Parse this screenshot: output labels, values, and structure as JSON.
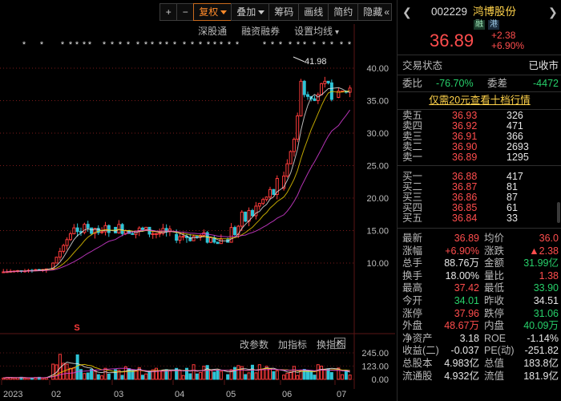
{
  "toolbar": {
    "plus": "+",
    "minus": "−",
    "fuquan": "复权",
    "diejia": "叠加",
    "chouma": "筹码",
    "huaxian": "画线",
    "jianyue": "简约",
    "yincang": "隐藏",
    "collapse": "«"
  },
  "chart_links": {
    "shen": "深股通",
    "rongzi": "融资融券",
    "settings": "设置均线"
  },
  "price_axis": [
    "40.00",
    "35.00",
    "30.00",
    "25.00",
    "20.00",
    "15.00",
    "10.00"
  ],
  "high_label": "41.98",
  "event_marker": "S",
  "volume_tools": {
    "params": "改参数",
    "add": "加指标",
    "change": "换指标",
    "close": "✕"
  },
  "volume_axis": [
    "245.00",
    "123.00",
    "0.00"
  ],
  "x_axis": [
    "2023",
    "02",
    "03",
    "04",
    "05",
    "06",
    "07"
  ],
  "chart_data": {
    "type": "candlestick",
    "y_axis_ticks": [
      10,
      15,
      20,
      25,
      30,
      35,
      40
    ],
    "volume_axis_ticks": [
      0,
      123,
      245
    ],
    "x_labels": [
      "2023",
      "02",
      "03",
      "04",
      "05",
      "06",
      "07"
    ],
    "high_annotation": 41.98,
    "colors": {
      "up": "#ff3b3b",
      "down": "#2ec4d6",
      "ma_white": "#e8e8e8",
      "ma_yellow": "#f0d000",
      "ma_magenta": "#e040e0"
    },
    "months": [
      {
        "month": "01",
        "open": 8.6,
        "high": 9.1,
        "low": 8.5,
        "close": 9.1
      },
      {
        "month": "02",
        "open": 9.1,
        "high": 17.5,
        "low": 9.0,
        "close": 15.5
      },
      {
        "month": "03",
        "open": 15.5,
        "high": 16.9,
        "low": 12.0,
        "close": 14.4
      },
      {
        "month": "04",
        "open": 14.4,
        "high": 18.6,
        "low": 13.0,
        "close": 13.6
      },
      {
        "month": "05",
        "open": 13.6,
        "high": 23.5,
        "low": 13.2,
        "close": 21.5
      },
      {
        "month": "06",
        "open": 21.5,
        "high": 41.98,
        "low": 21.0,
        "close": 35.5
      },
      {
        "month": "07",
        "open": 35.5,
        "high": 37.96,
        "low": 33.9,
        "close": 36.89
      }
    ]
  },
  "quote": {
    "code": "002229",
    "name": "鸿博股份",
    "tags": [
      "融",
      "港"
    ],
    "price": "36.89",
    "change": "+2.38",
    "change_pct": "+6.90%",
    "status_label": "交易状态",
    "status_value": "已收市",
    "weibi_label": "委比",
    "weibi_value": "-76.70%",
    "weicha_label": "委差",
    "weicha_value": "-4472",
    "promo": "仅需20元查看十档行情",
    "sell": [
      {
        "label": "卖五",
        "price": "36.93",
        "vol": "326"
      },
      {
        "label": "卖四",
        "price": "36.92",
        "vol": "471"
      },
      {
        "label": "卖三",
        "price": "36.91",
        "vol": "366"
      },
      {
        "label": "卖二",
        "price": "36.90",
        "vol": "2693"
      },
      {
        "label": "卖一",
        "price": "36.89",
        "vol": "1295"
      }
    ],
    "buy": [
      {
        "label": "买一",
        "price": "36.88",
        "vol": "417"
      },
      {
        "label": "买二",
        "price": "36.87",
        "vol": "81"
      },
      {
        "label": "买三",
        "price": "36.86",
        "vol": "87"
      },
      {
        "label": "买四",
        "price": "36.85",
        "vol": "61"
      },
      {
        "label": "买五",
        "price": "36.84",
        "vol": "33"
      }
    ],
    "stats": [
      {
        "l1": "最新",
        "v1": "36.89",
        "c1": "red",
        "l2": "均价",
        "v2": "36.0",
        "c2": "red"
      },
      {
        "l1": "涨幅",
        "v1": "+6.90%",
        "c1": "red",
        "l2": "涨跌",
        "v2": "▲2.38",
        "c2": "red"
      },
      {
        "l1": "总手",
        "v1": "88.76万",
        "c1": "white",
        "l2": "金额",
        "v2": "31.99亿",
        "c2": "green"
      },
      {
        "l1": "换手",
        "v1": "18.00%",
        "c1": "white",
        "l2": "量比",
        "v2": "1.38",
        "c2": "red"
      },
      {
        "l1": "最高",
        "v1": "37.42",
        "c1": "red",
        "l2": "最低",
        "v2": "33.90",
        "c2": "green"
      },
      {
        "l1": "今开",
        "v1": "34.01",
        "c1": "green",
        "l2": "昨收",
        "v2": "34.51",
        "c2": "white"
      },
      {
        "l1": "涨停",
        "v1": "37.96",
        "c1": "red",
        "l2": "跌停",
        "v2": "31.06",
        "c2": "green"
      },
      {
        "l1": "外盘",
        "v1": "48.67万",
        "c1": "red",
        "l2": "内盘",
        "v2": "40.09万",
        "c2": "green"
      },
      {
        "l1": "净资产",
        "v1": "3.18",
        "c1": "white",
        "l2": "ROE",
        "v2": "-1.14%",
        "c2": "white"
      },
      {
        "l1": "收益(二)",
        "v1": "-0.037",
        "c1": "white",
        "l2": "PE(动)",
        "v2": "-251.82",
        "c2": "white"
      },
      {
        "l1": "总股本",
        "v1": "4.983亿",
        "c1": "white",
        "l2": "总值",
        "v2": "183.8亿",
        "c2": "white"
      },
      {
        "l1": "流通股",
        "v1": "4.932亿",
        "c1": "white",
        "l2": "流值",
        "v2": "181.9亿",
        "c2": "white"
      }
    ]
  }
}
